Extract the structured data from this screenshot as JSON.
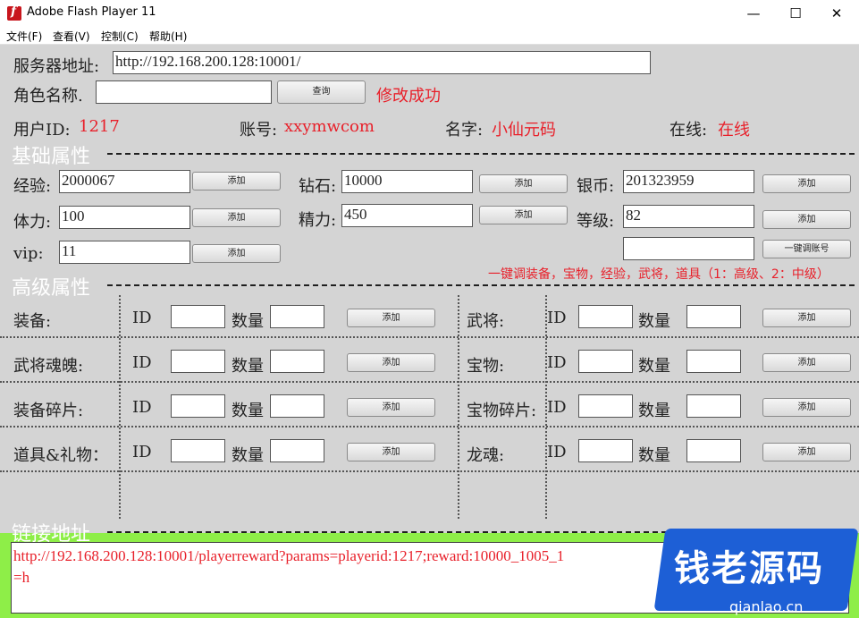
{
  "window": {
    "title": "Adobe Flash Player 11",
    "minimize": "—",
    "maximize": "☐",
    "close": "✕"
  },
  "menu": [
    "文件(F)",
    "查看(V)",
    "控制(C)",
    "帮助(H)"
  ],
  "server": {
    "label": "服务器地址:",
    "value": "http://192.168.200.128:10001/"
  },
  "role": {
    "label": "角色名称.",
    "value": "",
    "query_button": "查询",
    "status": "修改成功"
  },
  "info": {
    "uid_label": "用户ID:",
    "uid_value": "1217",
    "account_label": "账号:",
    "account_value": "xxymwcom",
    "name_label": "名字:",
    "name_value": "小仙元码",
    "online_label": "在线:",
    "online_value": "在线"
  },
  "basic": {
    "title": "基础属性",
    "add_label": "添加",
    "exp": {
      "label": "经验:",
      "value": "2000067"
    },
    "diamond": {
      "label": "钻石:",
      "value": "10000"
    },
    "silver": {
      "label": "银币:",
      "value": "201323959"
    },
    "stamina": {
      "label": "体力:",
      "value": "100"
    },
    "energy": {
      "label": "精力:",
      "value": "450"
    },
    "level": {
      "label": "等级:",
      "value": "82"
    },
    "vip": {
      "label": "vip:",
      "value": "11"
    },
    "onekey_value": "",
    "onekey_button": "一键调账号",
    "onekey_hint": "一键调装备，宝物，经验，武将，道具（1：高级、2：中级）"
  },
  "advanced": {
    "title": "高级属性",
    "id_label": "ID",
    "qty_label": "数量",
    "add_label": "添加",
    "rows": [
      {
        "left": "装备:",
        "right": "武将:"
      },
      {
        "left": "武将魂魄:",
        "right": "宝物:"
      },
      {
        "left": "装备碎片:",
        "right": "宝物碎片:"
      },
      {
        "left": "道具&礼物：",
        "right": "龙魂:"
      }
    ]
  },
  "link": {
    "title": "链接地址",
    "line1": "http://192.168.200.128:10001/playerreward?params=playerid:1217;reward:10000_1005_1",
    "line2": "=h"
  },
  "watermark": {
    "text": "钱老源码",
    "sub": "qianlao.cn"
  }
}
